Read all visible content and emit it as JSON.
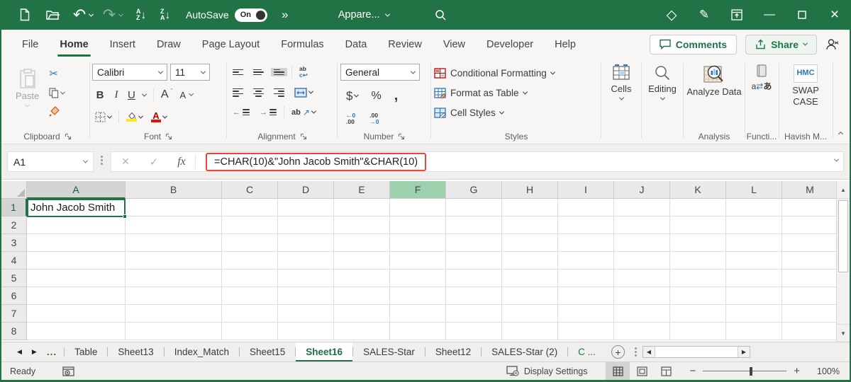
{
  "title_bar": {
    "autosave_label": "AutoSave",
    "autosave_state": "On",
    "overflow_glyph": "»",
    "file_name": "Appare..."
  },
  "ribbon_tabs": {
    "items": [
      {
        "label": "File"
      },
      {
        "label": "Home",
        "active": true
      },
      {
        "label": "Insert"
      },
      {
        "label": "Draw"
      },
      {
        "label": "Page Layout"
      },
      {
        "label": "Formulas"
      },
      {
        "label": "Data"
      },
      {
        "label": "Review"
      },
      {
        "label": "View"
      },
      {
        "label": "Developer"
      },
      {
        "label": "Help"
      }
    ],
    "comments_label": "Comments",
    "share_label": "Share"
  },
  "ribbon": {
    "clipboard": {
      "group_label": "Clipboard",
      "paste_label": "Paste"
    },
    "font": {
      "group_label": "Font",
      "font_name": "Calibri",
      "font_size": "11",
      "bold_label": "B",
      "italic_label": "I",
      "underline_label": "U",
      "grow_label": "A",
      "shrink_label": "A"
    },
    "alignment": {
      "group_label": "Alignment",
      "wrap_top": "ab",
      "orient_label": "ab"
    },
    "number": {
      "group_label": "Number",
      "format_name": "General",
      "currency_label": "$",
      "percent_label": "%",
      "comma_label": ",",
      "inc_top": "←0",
      "inc_bot": ".00",
      "dec_top": ".00",
      "dec_bot": "→0"
    },
    "styles": {
      "group_label": "Styles",
      "conditional_label": "Conditional Formatting",
      "table_label": "Format as Table",
      "cellstyles_label": "Cell Styles"
    },
    "cells": {
      "button_label": "Cells"
    },
    "editing": {
      "button_label": "Editing"
    },
    "analysis": {
      "button_label": "Analyze Data",
      "group_label": "Analysis"
    },
    "functions": {
      "group_label": "Functi..."
    },
    "addin": {
      "logo_text": "HMC",
      "button_label": "SWAP CASE",
      "group_label": "Havish M..."
    }
  },
  "formula_bar": {
    "name_box_value": "A1",
    "cancel_glyph": "×",
    "enter_glyph": "✓",
    "fx_label": "fx",
    "formula": "=CHAR(10)&\"John Jacob Smith\"&CHAR(10)"
  },
  "grid": {
    "column_letters": [
      "A",
      "B",
      "C",
      "D",
      "E",
      "F",
      "G",
      "H",
      "I",
      "J",
      "K",
      "L",
      "M"
    ],
    "selected_column": "A",
    "highlighted_column": "F",
    "row_numbers": [
      "1",
      "2",
      "3",
      "4",
      "5",
      "6",
      "7",
      "8"
    ],
    "cells": {
      "A1": "John Jacob Smith"
    }
  },
  "sheet_tabs": {
    "left_ellipsis": "...",
    "tabs": [
      {
        "label": "Table"
      },
      {
        "label": "Sheet13"
      },
      {
        "label": "Index_Match"
      },
      {
        "label": "Sheet15"
      },
      {
        "label": "Sheet16",
        "active": true
      },
      {
        "label": "SALES-Star"
      },
      {
        "label": "Sheet12"
      },
      {
        "label": "SALES-Star (2)"
      },
      {
        "label": "C ...",
        "partial": true
      }
    ]
  },
  "status_bar": {
    "mode": "Ready",
    "display_settings_label": "Display Settings",
    "zoom_percent": "100%"
  },
  "colors": {
    "excel_green": "#217346",
    "formula_highlight": "#e8453c",
    "column_highlight": "#9fd0ae"
  }
}
